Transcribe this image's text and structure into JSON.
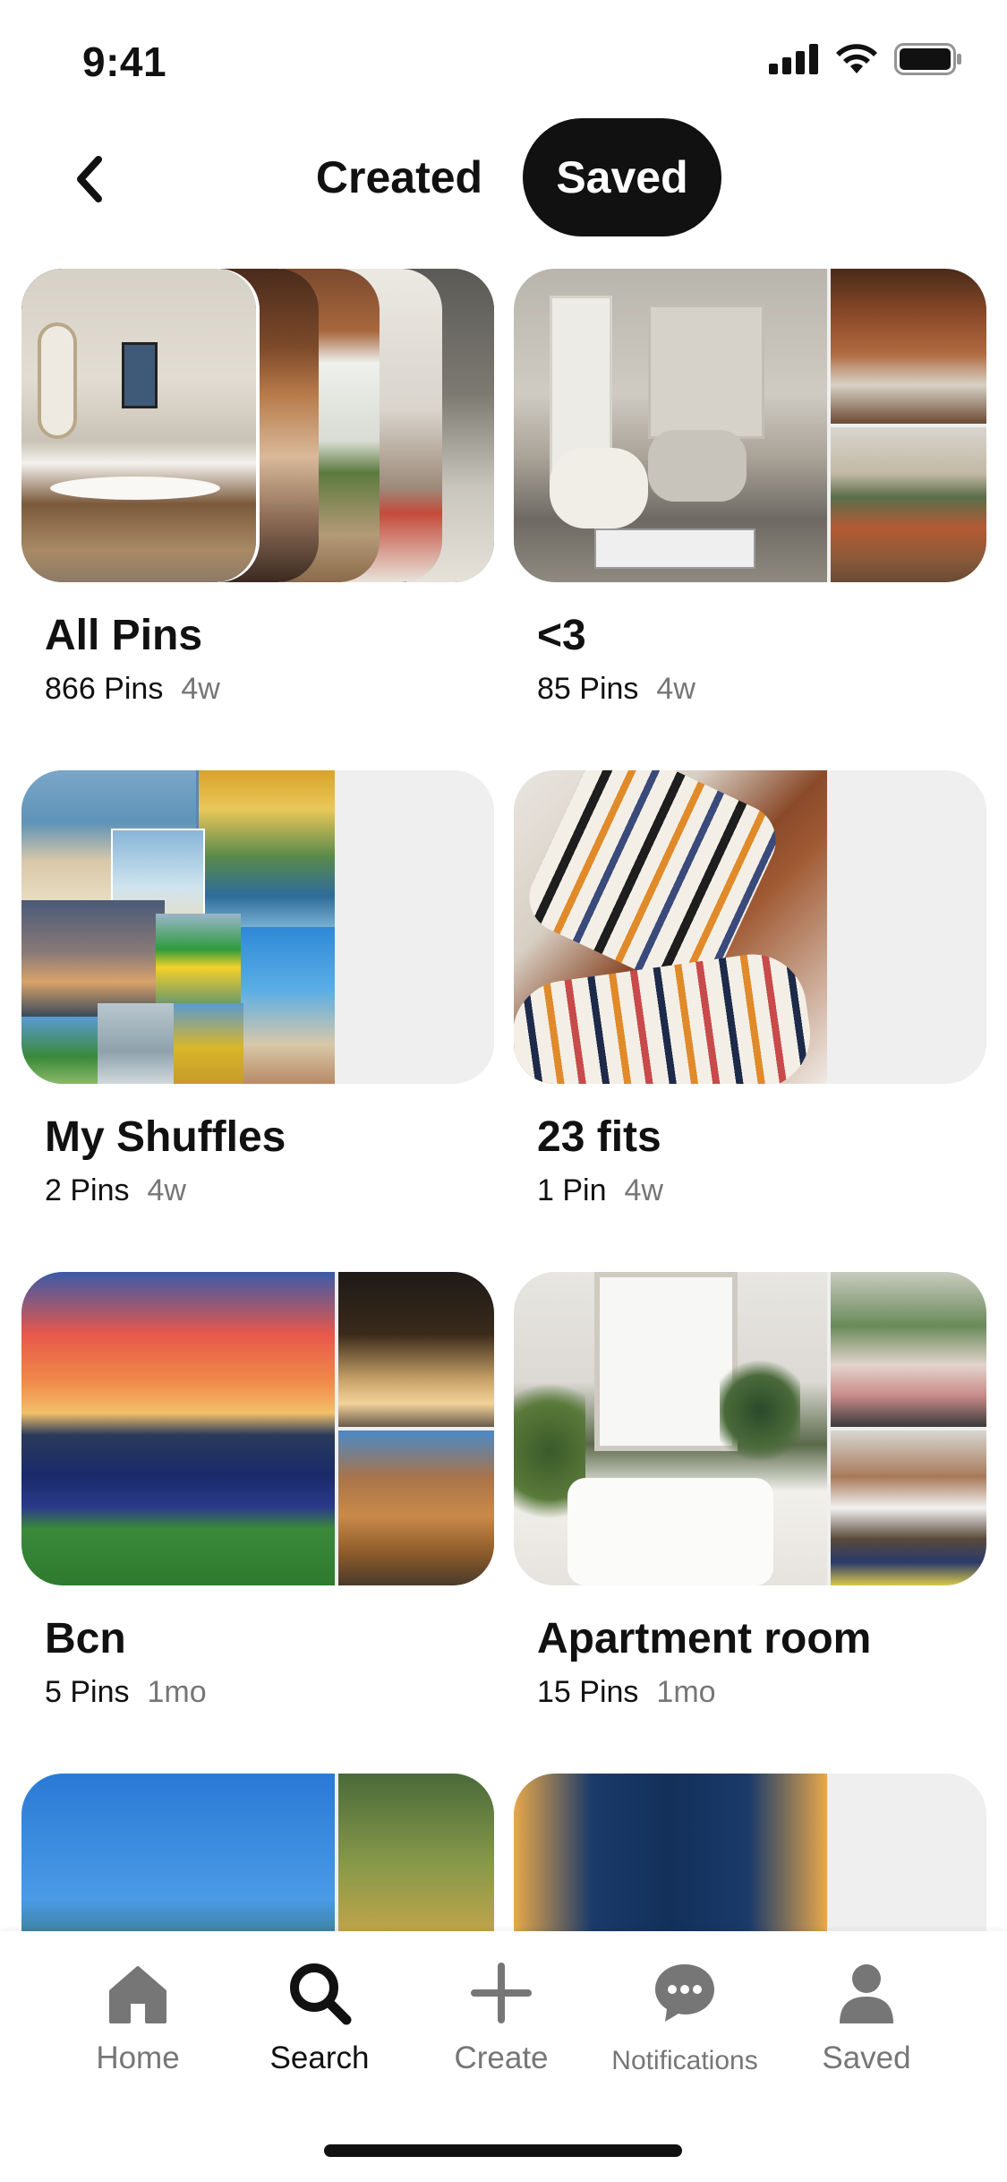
{
  "status_bar": {
    "time": "9:41"
  },
  "top_nav": {
    "tabs": [
      {
        "label": "Created"
      },
      {
        "label": "Saved"
      }
    ]
  },
  "boards": [
    {
      "title": "All Pins",
      "count": "866 Pins",
      "age": "4w"
    },
    {
      "title": "<3",
      "count": "85 Pins",
      "age": "4w"
    },
    {
      "title": "My Shuffles",
      "count": "2 Pins",
      "age": "4w"
    },
    {
      "title": "23 fits",
      "count": "1 Pin",
      "age": "4w"
    },
    {
      "title": "Bcn",
      "count": "5 Pins",
      "age": "1mo"
    },
    {
      "title": "Apartment room",
      "count": "15 Pins",
      "age": "1mo"
    }
  ],
  "tab_bar": {
    "items": [
      {
        "label": "Home",
        "icon": "home-icon"
      },
      {
        "label": "Search",
        "icon": "search-icon"
      },
      {
        "label": "Create",
        "icon": "plus-icon"
      },
      {
        "label": "Notifications",
        "icon": "chat-bubble-icon"
      },
      {
        "label": "Saved",
        "icon": "person-icon"
      }
    ],
    "active": "Search"
  },
  "colors": {
    "text_primary": "#111111",
    "text_secondary": "#767676",
    "placeholder": "#efefef",
    "active_pill": "#111111"
  }
}
